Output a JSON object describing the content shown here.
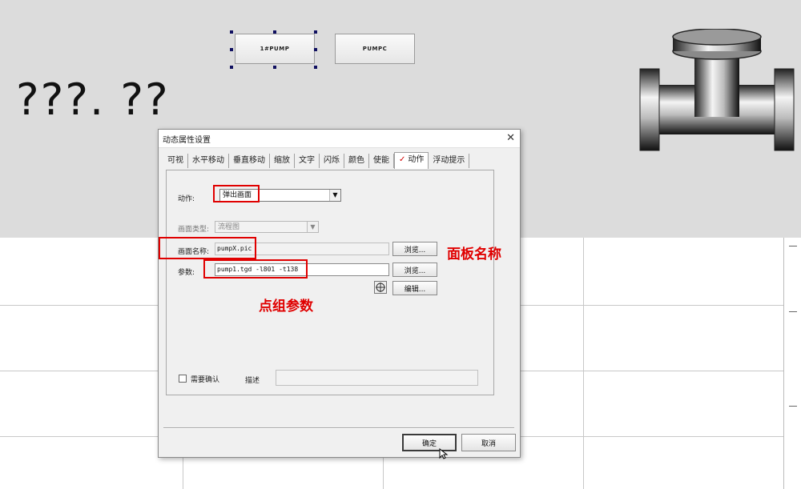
{
  "canvas": {
    "big_text": "???. ??",
    "buttons": [
      {
        "label": "1#PUMP"
      },
      {
        "label": "PUMPC"
      }
    ]
  },
  "dialog": {
    "title": "动态属性设置",
    "close_glyph": "✕",
    "tabs": [
      {
        "label": "可视"
      },
      {
        "label": "水平移动"
      },
      {
        "label": "垂直移动"
      },
      {
        "label": "缩放"
      },
      {
        "label": "文字"
      },
      {
        "label": "闪烁"
      },
      {
        "label": "颜色"
      },
      {
        "label": "使能"
      },
      {
        "label": "动作",
        "active": true,
        "check": "✓"
      },
      {
        "label": "浮动提示"
      }
    ],
    "action": {
      "label": "动作:",
      "value": "弹出画面"
    },
    "screen_type": {
      "label": "画面类型:",
      "value": "流程图"
    },
    "screen_name": {
      "label": "画面名称:",
      "value": "pumpX.pic",
      "browse_label": "浏览..."
    },
    "params": {
      "label": "参数:",
      "value": "pump1.tgd -l801 -t138",
      "browse_label": "浏览...",
      "edit_label": "编辑..."
    },
    "confirm": {
      "label": "需要确认"
    },
    "description": {
      "label": "描述",
      "value": ""
    },
    "ok_label": "确定",
    "cancel_label": "取消"
  },
  "annotations": {
    "panel_name": "面板名称",
    "point_group_params": "点组参数"
  },
  "colors": {
    "annotation_red": "#e00000",
    "canvas_gray": "#dcdcdc",
    "dialog_bg": "#f0f0f0"
  }
}
